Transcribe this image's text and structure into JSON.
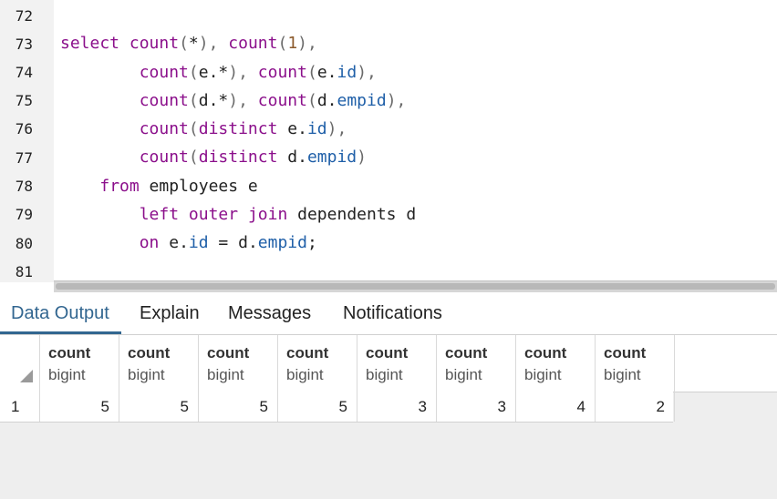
{
  "editor": {
    "line_numbers": [
      "72",
      "73",
      "74",
      "75",
      "76",
      "77",
      "78",
      "79",
      "80",
      "81"
    ],
    "lines": [
      "",
      "select count(*), count(1),",
      "        count(e.*), count(e.id),",
      "        count(d.*), count(d.empid),",
      "        count(distinct e.id),",
      "        count(distinct d.empid)",
      "    from employees e",
      "        left outer join dependents d",
      "        on e.id = d.empid;",
      ""
    ]
  },
  "tabs": {
    "data_output": "Data Output",
    "explain": "Explain",
    "messages": "Messages",
    "notifications": "Notifications"
  },
  "grid": {
    "columns": [
      {
        "name": "count",
        "type": "bigint"
      },
      {
        "name": "count",
        "type": "bigint"
      },
      {
        "name": "count",
        "type": "bigint"
      },
      {
        "name": "count",
        "type": "bigint"
      },
      {
        "name": "count",
        "type": "bigint"
      },
      {
        "name": "count",
        "type": "bigint"
      },
      {
        "name": "count",
        "type": "bigint"
      },
      {
        "name": "count",
        "type": "bigint"
      }
    ],
    "rows": [
      {
        "num": "1",
        "values": [
          "5",
          "5",
          "5",
          "5",
          "3",
          "3",
          "4",
          "2"
        ]
      }
    ]
  },
  "colors": {
    "keyword": "#8b0f8b",
    "number": "#8b5a2b",
    "property": "#1f5fa8",
    "active_tab": "#326690"
  }
}
